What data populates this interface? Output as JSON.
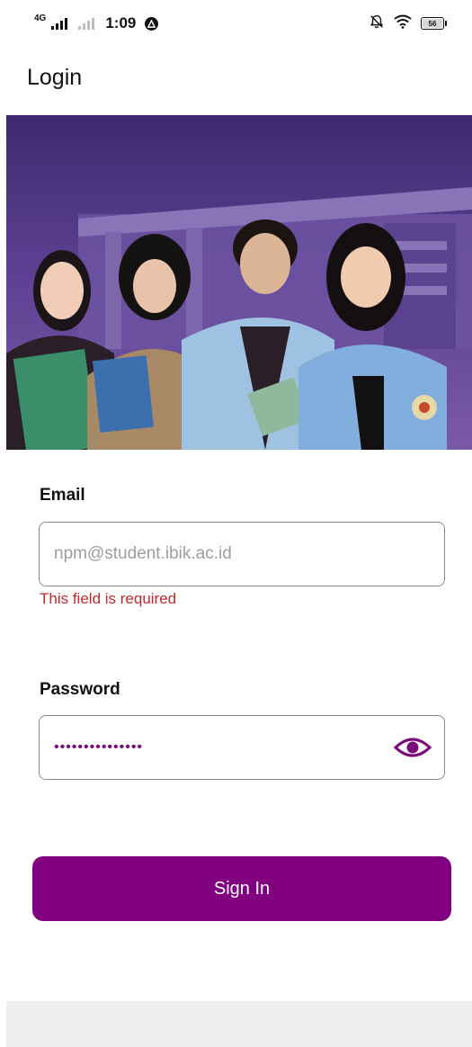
{
  "status_bar": {
    "network": "4G",
    "time": "1:09",
    "battery": "56"
  },
  "header": {
    "title": "Login"
  },
  "login_form": {
    "email": {
      "label": "Email",
      "placeholder": "npm@student.ibik.ac.id",
      "value": "",
      "error": "This field is required"
    },
    "password": {
      "label": "Password",
      "value": "•••••••••••••••"
    },
    "submit_label": "Sign In"
  },
  "colors": {
    "primary": "#800080",
    "error": "#c62828",
    "border": "#8a8a8a",
    "placeholder": "#9e9e9e"
  },
  "icons": {
    "status_notification": "a-circle-icon",
    "silent": "bell-off-icon",
    "wifi": "wifi-icon",
    "battery": "battery-icon",
    "password_toggle": "eye-icon"
  }
}
